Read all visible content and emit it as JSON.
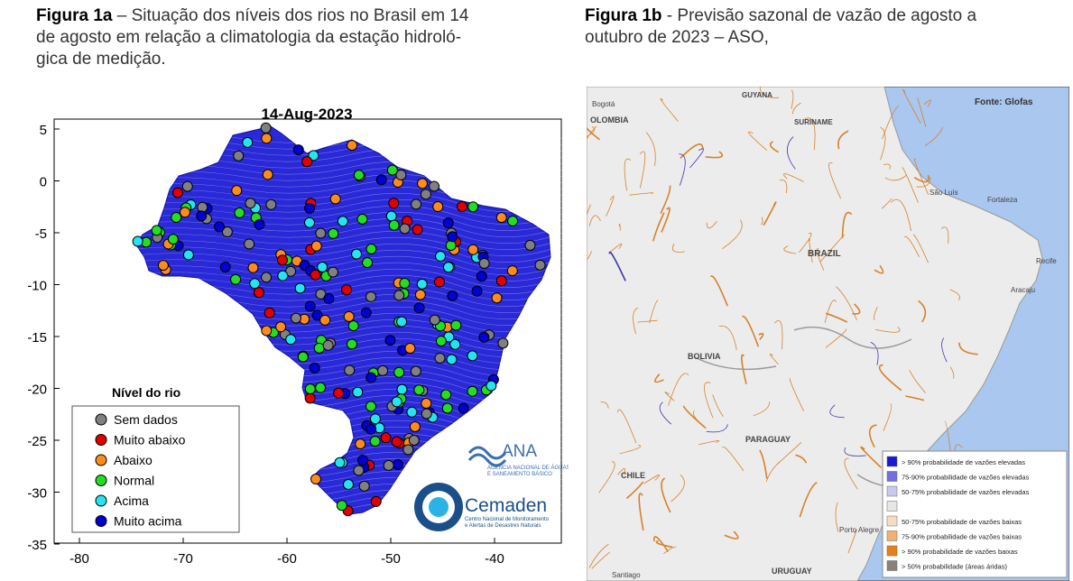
{
  "fig_a": {
    "caption_label": "Figura 1a",
    "caption_text_1": " – Situação dos níveis dos rios no Brasil em 14",
    "caption_text_2": "de agosto em relação a climatologia da estação hidroló-",
    "caption_text_3": "gica de medição.",
    "title": "14-Aug-2023",
    "y_ticks": [
      "5",
      "0",
      "-5",
      "-10",
      "-15",
      "-20",
      "-25",
      "-30",
      "-35"
    ],
    "x_ticks": [
      "-80",
      "-70",
      "-60",
      "-50",
      "-40"
    ],
    "legend": {
      "title": "Nível do rio",
      "entries": [
        {
          "label": "Sem dados",
          "color": "#808080"
        },
        {
          "label": "Muito abaixo",
          "color": "#e00000"
        },
        {
          "label": "Abaixo",
          "color": "#ff8c1a"
        },
        {
          "label": "Normal",
          "color": "#22dd22"
        },
        {
          "label": "Acima",
          "color": "#22e5f0"
        },
        {
          "label": "Muito acima",
          "color": "#0000d0"
        }
      ]
    },
    "logo_ana": "ANA",
    "logo_ana_sub1": "AGÊNCIA NACIONAL DE ÁGUAS",
    "logo_ana_sub2": "E SANEAMENTO BÁSICO",
    "logo_cemaden": "Cemaden",
    "logo_cemaden_sub1": "Centro Nacional de Monitoramento",
    "logo_cemaden_sub2": "e Alertas de Desastres Naturais"
  },
  "fig_b": {
    "caption_label": "Figura 1b",
    "caption_text_1": " -  Previsão sazonal de vazão de agosto a",
    "caption_text_2": "outubro de 2023 – ASO,",
    "source": "Fonte: Glofas",
    "places": {
      "guyana": "GUYANA",
      "suriname": "SURINAME",
      "colombia": "OLOMBIA",
      "bogota": "Bogotá",
      "brazil": "BRAZIL",
      "bolivia": "BOLIVIA",
      "paraguay": "PARAGUAY",
      "chile": "CHILE",
      "uruguay": "URUGUAY",
      "sao_luis": "São Luís",
      "fortaleza": "Fortaleza",
      "recife": "Recife",
      "aracaju": "Aracaju",
      "porto_alegre": "Porto Alegre",
      "santiago": "Santiago"
    },
    "legend": [
      {
        "label": "> 90% probabilidade de vazões elevadas",
        "color": "#1a1ad4"
      },
      {
        "label": "75-90% probabilidade de vazões elevadas",
        "color": "#7070e0"
      },
      {
        "label": "50-75% probabilidade de vazões elevadas",
        "color": "#c8c8f0"
      },
      {
        "label": "",
        "color": "#e6e6e6"
      },
      {
        "label": "50-75% probabilidade de vazões baixas",
        "color": "#f8dcc0"
      },
      {
        "label": "75-90% probabilidade de vazões baixas",
        "color": "#f3b070"
      },
      {
        "label": "> 90% probabilidade de vazões baixas",
        "color": "#e8801a"
      },
      {
        "label": "> 50% probabilidade (áreas áridas)",
        "color": "#8a8278"
      }
    ]
  }
}
